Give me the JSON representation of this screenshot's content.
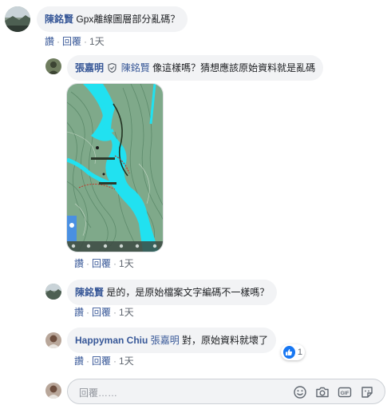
{
  "comments": [
    {
      "author": "陳銘賢",
      "text": "Gpx離線圖層部分亂碼？",
      "actions": {
        "like": "讚",
        "reply": "回覆",
        "time": "1天"
      }
    }
  ],
  "replies": [
    {
      "author": "張嘉明",
      "mention": "陳銘賢",
      "text": "像這樣嗎？猜想應該原始資料就是亂碼",
      "actions": {
        "like": "讚",
        "reply": "回覆",
        "time": "1天"
      }
    },
    {
      "author": "陳銘賢",
      "text": "是的，是原始檔案文字編碼不一樣嗎？",
      "actions": {
        "like": "讚",
        "reply": "回覆",
        "time": "1天"
      }
    },
    {
      "author": "Happyman Chiu",
      "mention": "張嘉明",
      "text": "對，原始資料就壞了",
      "reaction_count": "1",
      "actions": {
        "like": "讚",
        "reply": "回覆",
        "time": "1天"
      }
    }
  ],
  "composer": {
    "placeholder": "回覆……",
    "icons": [
      "smiley-icon",
      "camera-icon",
      "gif-icon",
      "sticker-icon"
    ]
  },
  "colors": {
    "link": "#385898",
    "bubble": "#f2f3f5",
    "like_blue": "#1877f2",
    "map_water": "#21e1f0",
    "map_land": "#7fa98a"
  },
  "icons": {
    "verified": "shield-check-icon",
    "like": "thumbs-up-icon"
  }
}
